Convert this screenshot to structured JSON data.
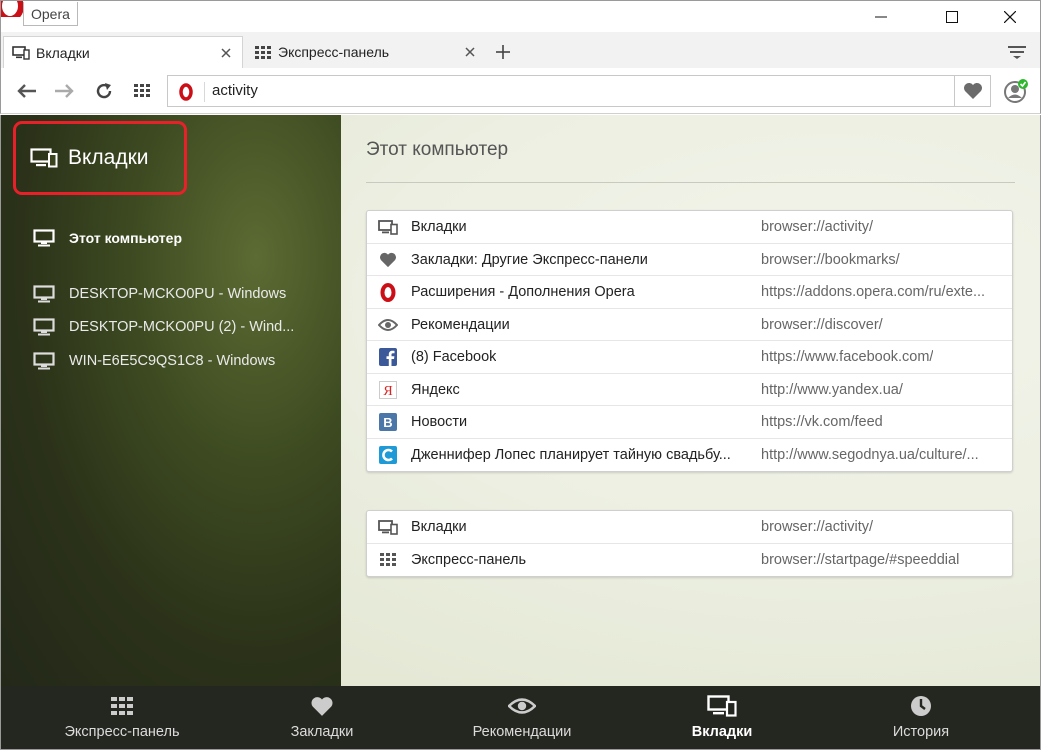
{
  "window": {
    "title": "Opera"
  },
  "tabs": [
    {
      "label": "Вкладки",
      "active": true,
      "icon": "devices-icon"
    },
    {
      "label": "Экспресс-панель",
      "active": false,
      "icon": "grid-icon"
    }
  ],
  "address_bar": {
    "url": "activity"
  },
  "sidebar": {
    "title": "Вкладки",
    "current_device": "Этот компьютер",
    "devices": [
      "DESKTOP-MCKO0PU - Windows",
      "DESKTOP-MCKO0PU (2) - Wind...",
      "WIN-E6E5C9QS1C8 - Windows"
    ]
  },
  "main": {
    "title": "Этот компьютер",
    "open_tabs": [
      {
        "title": "Вкладки",
        "url": "browser://activity/",
        "icon": "devices-icon"
      },
      {
        "title": "Закладки: Другие Экспресс-панели",
        "url": "browser://bookmarks/",
        "icon": "heart-icon"
      },
      {
        "title": "Расширения - Дополнения Opera",
        "url": "https://addons.opera.com/ru/exte...",
        "icon": "opera-icon"
      },
      {
        "title": "Рекомендации",
        "url": "browser://discover/",
        "icon": "eye-icon"
      },
      {
        "title": "(8) Facebook",
        "url": "https://www.facebook.com/",
        "icon": "facebook-icon"
      },
      {
        "title": "Яндекс",
        "url": "http://www.yandex.ua/",
        "icon": "yandex-icon"
      },
      {
        "title": "Новости",
        "url": "https://vk.com/feed",
        "icon": "vk-icon"
      },
      {
        "title": "Дженнифер Лопес планирует тайную свадьбу...",
        "url": "http://www.segodnya.ua/culture/...",
        "icon": "segodnya-icon"
      }
    ],
    "second_window_tabs": [
      {
        "title": "Вкладки",
        "url": "browser://activity/",
        "icon": "devices-icon"
      },
      {
        "title": "Экспресс-панель",
        "url": "browser://startpage/#speeddial",
        "icon": "grid-icon"
      }
    ]
  },
  "bottom_nav": [
    {
      "label": "Экспресс-панель",
      "icon": "grid-icon",
      "active": false
    },
    {
      "label": "Закладки",
      "icon": "heart-icon",
      "active": false
    },
    {
      "label": "Рекомендации",
      "icon": "eye-icon",
      "active": false
    },
    {
      "label": "Вкладки",
      "icon": "devices-icon",
      "active": true
    },
    {
      "label": "История",
      "icon": "clock-icon",
      "active": false
    }
  ],
  "colors": {
    "highlight": "#e8202a",
    "opera_red": "#cc0f16",
    "facebook": "#3b5998",
    "vk": "#4a76a8",
    "segodnya": "#1e9bd7",
    "account_badge": "#2eb82e"
  }
}
